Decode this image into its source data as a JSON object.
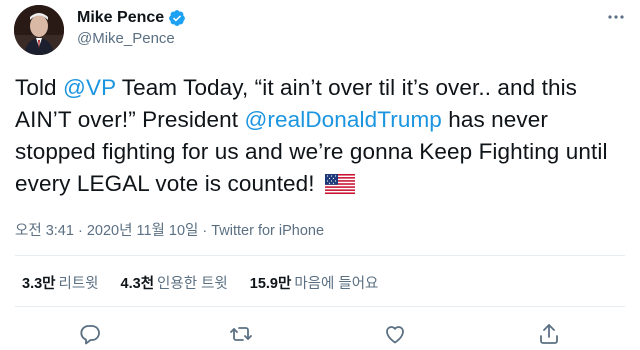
{
  "author": {
    "display_name": "Mike Pence",
    "handle": "@Mike_Pence",
    "verified": true
  },
  "tweet": {
    "text_parts": [
      {
        "type": "text",
        "value": "Told "
      },
      {
        "type": "mention",
        "value": "@VP"
      },
      {
        "type": "text",
        "value": " Team Today, “it ain’t over til it’s over.. and this AIN’T over!” President "
      },
      {
        "type": "mention",
        "value": "@realDonaldTrump"
      },
      {
        "type": "text",
        "value": " has never stopped fighting for us and we’re gonna Keep Fighting until every LEGAL vote is counted! "
      }
    ],
    "emoji": "us-flag-emoji"
  },
  "meta": {
    "time": "오전 3:41",
    "separator": " · ",
    "date": "2020년 11월 10일",
    "source": "Twitter for iPhone"
  },
  "stats": {
    "retweets": {
      "count": "3.3만",
      "label": "리트윗"
    },
    "quotes": {
      "count": "4.3천",
      "label": "인용한 트윗"
    },
    "likes": {
      "count": "15.9만",
      "label": "마음에 들어요"
    }
  },
  "actions": [
    "reply-icon",
    "retweet-icon",
    "like-icon",
    "share-icon"
  ],
  "colors": {
    "link": "#1b95e0",
    "secondary_text": "#5b7083",
    "primary_text": "#0f1419",
    "verified": "#1da1f2",
    "divider": "#e6ecf0"
  }
}
